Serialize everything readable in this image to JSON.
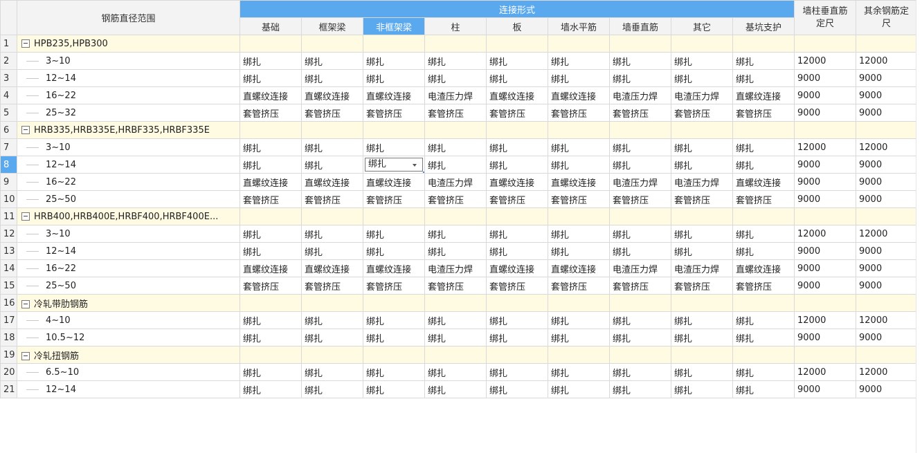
{
  "header": {
    "col_range": "钢筋直径范围",
    "group_title": "连接形式",
    "connection_cols": [
      "基础",
      "框架梁",
      "非框架梁",
      "柱",
      "板",
      "墙水平筋",
      "墙垂直筋",
      "其它",
      "基坑支护"
    ],
    "col_wall_line1": "墙柱垂直筋",
    "col_wall_line2": "定尺",
    "col_other_line1": "其余钢筋定",
    "col_other_line2": "尺"
  },
  "rows": [
    {
      "num": "1",
      "type": "group",
      "name": "HPB235,HPB300"
    },
    {
      "num": "2",
      "type": "item",
      "name": "3~10",
      "cells": [
        "绑扎",
        "绑扎",
        "绑扎",
        "绑扎",
        "绑扎",
        "绑扎",
        "绑扎",
        "绑扎",
        "绑扎"
      ],
      "len1": "12000",
      "len2": "12000"
    },
    {
      "num": "3",
      "type": "item",
      "name": "12~14",
      "cells": [
        "绑扎",
        "绑扎",
        "绑扎",
        "绑扎",
        "绑扎",
        "绑扎",
        "绑扎",
        "绑扎",
        "绑扎"
      ],
      "len1": "9000",
      "len2": "9000"
    },
    {
      "num": "4",
      "type": "item",
      "name": "16~22",
      "cells": [
        "直螺纹连接",
        "直螺纹连接",
        "直螺纹连接",
        "电渣压力焊",
        "直螺纹连接",
        "直螺纹连接",
        "电渣压力焊",
        "电渣压力焊",
        "直螺纹连接"
      ],
      "len1": "9000",
      "len2": "9000"
    },
    {
      "num": "5",
      "type": "item",
      "name": "25~32",
      "cells": [
        "套管挤压",
        "套管挤压",
        "套管挤压",
        "套管挤压",
        "套管挤压",
        "套管挤压",
        "套管挤压",
        "套管挤压",
        "套管挤压"
      ],
      "len1": "9000",
      "len2": "9000"
    },
    {
      "num": "6",
      "type": "group",
      "name": "HRB335,HRB335E,HRBF335,HRBF335E"
    },
    {
      "num": "7",
      "type": "item",
      "name": "3~10",
      "cells": [
        "绑扎",
        "绑扎",
        "绑扎",
        "绑扎",
        "绑扎",
        "绑扎",
        "绑扎",
        "绑扎",
        "绑扎"
      ],
      "len1": "12000",
      "len2": "12000"
    },
    {
      "num": "8",
      "type": "item",
      "active": true,
      "name": "12~14",
      "cells": [
        "绑扎",
        "绑扎",
        "绑扎",
        "绑扎",
        "绑扎",
        "绑扎",
        "绑扎",
        "绑扎",
        "绑扎"
      ],
      "len1": "9000",
      "len2": "9000"
    },
    {
      "num": "9",
      "type": "item",
      "name": "16~22",
      "cells": [
        "直螺纹连接",
        "直螺纹连接",
        "直螺纹连接",
        "电渣压力焊",
        "直螺纹连接",
        "直螺纹连接",
        "电渣压力焊",
        "电渣压力焊",
        "直螺纹连接"
      ],
      "len1": "9000",
      "len2": "9000"
    },
    {
      "num": "10",
      "type": "item",
      "name": "25~50",
      "cells": [
        "套管挤压",
        "套管挤压",
        "套管挤压",
        "套管挤压",
        "套管挤压",
        "套管挤压",
        "套管挤压",
        "套管挤压",
        "套管挤压"
      ],
      "len1": "9000",
      "len2": "9000"
    },
    {
      "num": "11",
      "type": "group",
      "name": "HRB400,HRB400E,HRBF400,HRBF400E..."
    },
    {
      "num": "12",
      "type": "item",
      "name": "3~10",
      "cells": [
        "绑扎",
        "绑扎",
        "绑扎",
        "绑扎",
        "绑扎",
        "绑扎",
        "绑扎",
        "绑扎",
        "绑扎"
      ],
      "len1": "12000",
      "len2": "12000"
    },
    {
      "num": "13",
      "type": "item",
      "name": "12~14",
      "cells": [
        "绑扎",
        "绑扎",
        "绑扎",
        "绑扎",
        "绑扎",
        "绑扎",
        "绑扎",
        "绑扎",
        "绑扎"
      ],
      "len1": "9000",
      "len2": "9000"
    },
    {
      "num": "14",
      "type": "item",
      "name": "16~22",
      "cells": [
        "直螺纹连接",
        "直螺纹连接",
        "直螺纹连接",
        "电渣压力焊",
        "直螺纹连接",
        "直螺纹连接",
        "电渣压力焊",
        "电渣压力焊",
        "直螺纹连接"
      ],
      "len1": "9000",
      "len2": "9000"
    },
    {
      "num": "15",
      "type": "item",
      "name": "25~50",
      "cells": [
        "套管挤压",
        "套管挤压",
        "套管挤压",
        "套管挤压",
        "套管挤压",
        "套管挤压",
        "套管挤压",
        "套管挤压",
        "套管挤压"
      ],
      "len1": "9000",
      "len2": "9000"
    },
    {
      "num": "16",
      "type": "group",
      "name": "冷轧带肋钢筋"
    },
    {
      "num": "17",
      "type": "item",
      "name": "4~10",
      "cells": [
        "绑扎",
        "绑扎",
        "绑扎",
        "绑扎",
        "绑扎",
        "绑扎",
        "绑扎",
        "绑扎",
        "绑扎"
      ],
      "len1": "12000",
      "len2": "12000"
    },
    {
      "num": "18",
      "type": "item",
      "name": "10.5~12",
      "cells": [
        "绑扎",
        "绑扎",
        "绑扎",
        "绑扎",
        "绑扎",
        "绑扎",
        "绑扎",
        "绑扎",
        "绑扎"
      ],
      "len1": "9000",
      "len2": "9000"
    },
    {
      "num": "19",
      "type": "group",
      "name": "冷轧扭钢筋"
    },
    {
      "num": "20",
      "type": "item",
      "name": "6.5~10",
      "cells": [
        "绑扎",
        "绑扎",
        "绑扎",
        "绑扎",
        "绑扎",
        "绑扎",
        "绑扎",
        "绑扎",
        "绑扎"
      ],
      "len1": "12000",
      "len2": "12000"
    },
    {
      "num": "21",
      "type": "item",
      "name": "12~14",
      "cells": [
        "绑扎",
        "绑扎",
        "绑扎",
        "绑扎",
        "绑扎",
        "绑扎",
        "绑扎",
        "绑扎",
        "绑扎"
      ],
      "len1": "9000",
      "len2": "9000"
    }
  ],
  "selection": {
    "row_num": "8",
    "col_index": 2
  },
  "colors": {
    "header_accent": "#5aa9ef",
    "group_row_bg": "#fffbe3",
    "grid_line": "#d9d9d9"
  },
  "icons": {
    "group_toggle": "collapse-minus-icon",
    "dropdown": "chevron-down-icon"
  }
}
